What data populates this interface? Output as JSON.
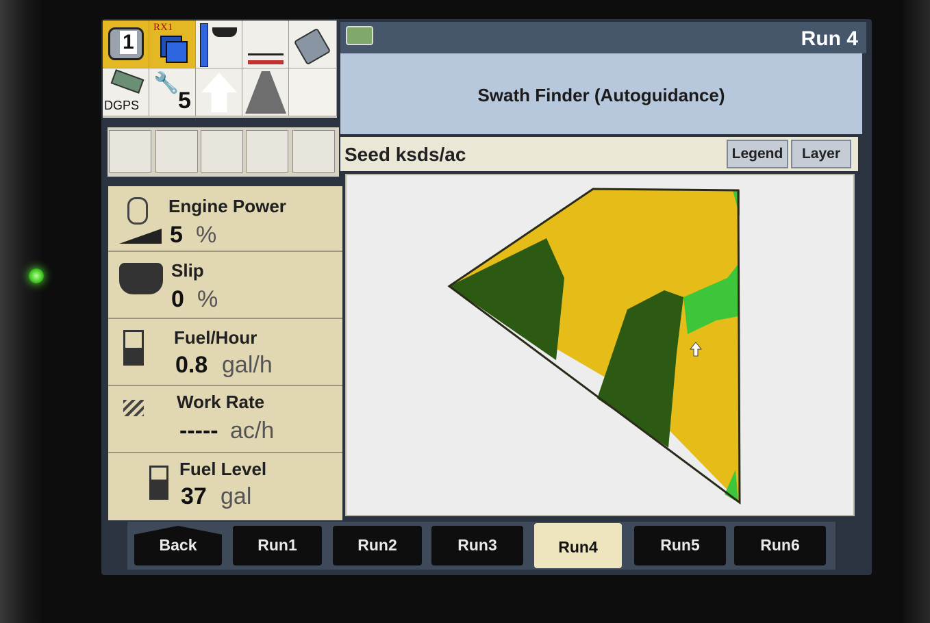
{
  "header": {
    "run_title": "Run 4",
    "subtitle": "Swath Finder (Autoguidance)"
  },
  "icons": {
    "row1": [
      "1",
      "RX1",
      "",
      "",
      ""
    ],
    "gps_label": "DGPS",
    "wrench_count": "5"
  },
  "stats": [
    {
      "label": "Engine Power",
      "value": "5",
      "unit": "%"
    },
    {
      "label": "Slip",
      "value": "0",
      "unit": "%"
    },
    {
      "label": "Fuel/Hour",
      "value": "0.8",
      "unit": "gal/h"
    },
    {
      "label": "Work Rate",
      "value": "-----",
      "unit": "ac/h"
    },
    {
      "label": "Fuel Level",
      "value": "37",
      "unit": "gal"
    }
  ],
  "map": {
    "layer_title": "Seed ksds/ac",
    "legend_label": "Legend",
    "layer_label": "Layer",
    "colors": {
      "yellow": "#e6bd18",
      "dark_green": "#2d5a12",
      "light_green": "#3ec63a",
      "outline": "#2a2a1a"
    }
  },
  "tabs": [
    {
      "label": "Back"
    },
    {
      "label": "Run1"
    },
    {
      "label": "Run2"
    },
    {
      "label": "Run3"
    },
    {
      "label": "Run4",
      "active": true
    },
    {
      "label": "Run5"
    },
    {
      "label": "Run6"
    }
  ]
}
